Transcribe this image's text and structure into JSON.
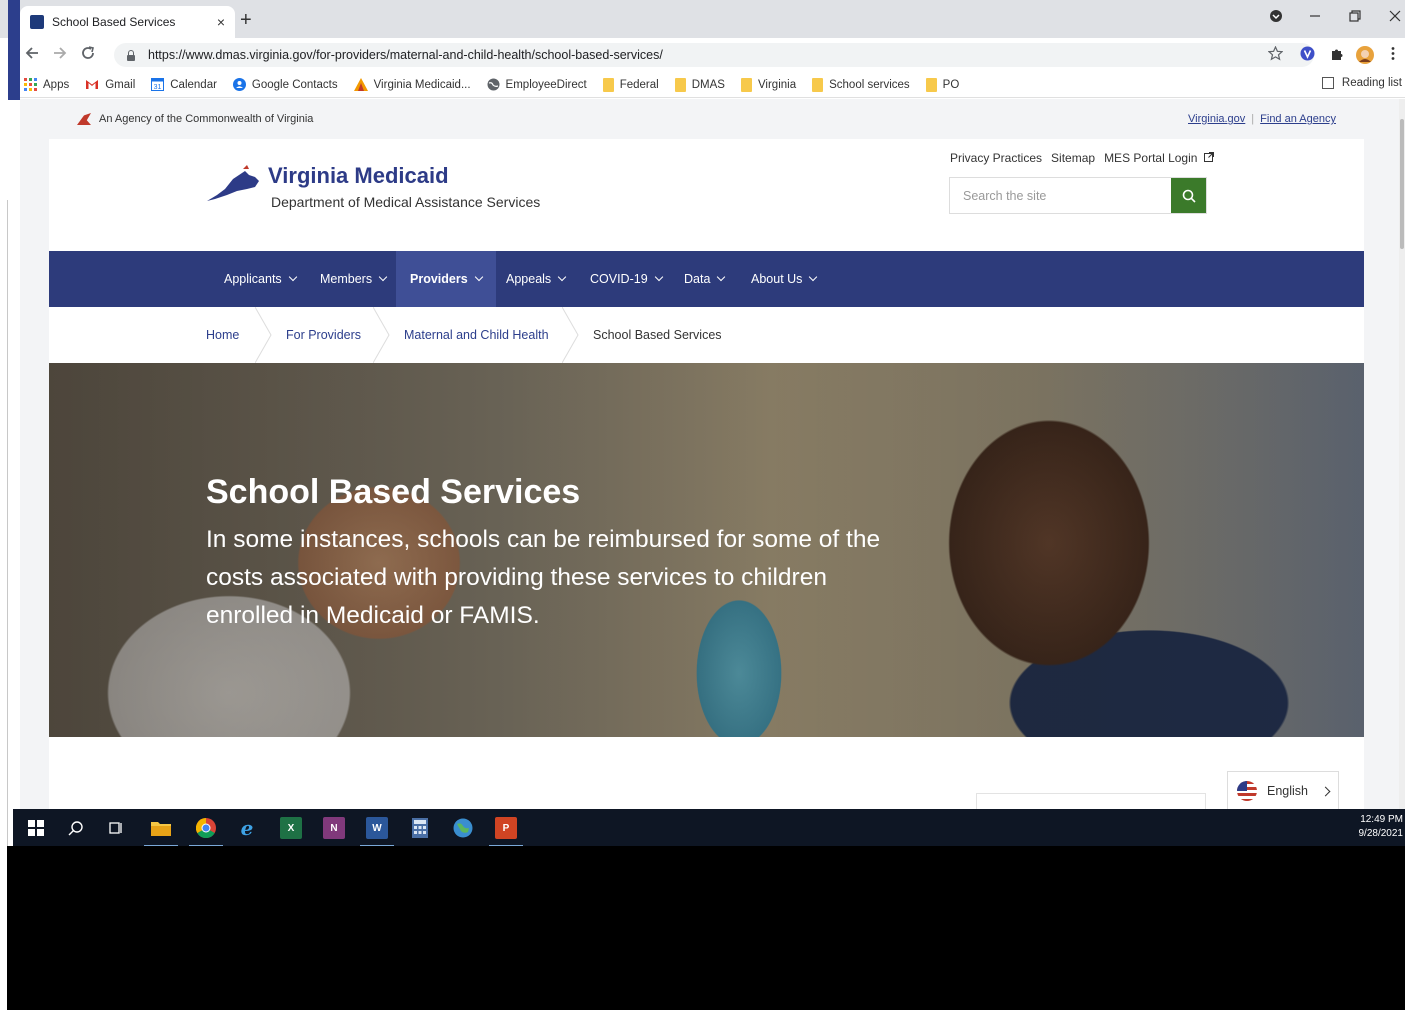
{
  "browser": {
    "tab_title": "School Based Services",
    "tab_close": "×",
    "new_tab": "+",
    "url": "https://www.dmas.virginia.gov/for-providers/maternal-and-child-health/school-based-services/",
    "bookmarks": [
      {
        "label": "Apps",
        "icon": "apps-grid-icon",
        "color": "#e44c41"
      },
      {
        "label": "Gmail",
        "icon": "gmail-icon",
        "color": "#d93025"
      },
      {
        "label": "Calendar",
        "icon": "calendar-icon",
        "color": "#1a73e8"
      },
      {
        "label": "Google Contacts",
        "icon": "contacts-icon",
        "color": "#1a73e8"
      },
      {
        "label": "Virginia Medicaid...",
        "icon": "medicaid-icon",
        "color": "#f29900"
      },
      {
        "label": "EmployeeDirect",
        "icon": "globe-icon",
        "color": "#5f6368"
      },
      {
        "label": "Federal",
        "icon": "folder-icon",
        "color": "#f7c94b"
      },
      {
        "label": "DMAS",
        "icon": "folder-icon",
        "color": "#f7c94b"
      },
      {
        "label": "Virginia",
        "icon": "folder-icon",
        "color": "#f7c94b"
      },
      {
        "label": "School services",
        "icon": "folder-icon",
        "color": "#f7c94b"
      },
      {
        "label": "PO",
        "icon": "folder-icon",
        "color": "#f7c94b"
      }
    ],
    "reading_list": "Reading list"
  },
  "site": {
    "agency_text": "An Agency of the Commonwealth of Virginia",
    "top_links": [
      "Virginia.gov",
      "Find an Agency"
    ],
    "logo_title": "Virginia Medicaid",
    "logo_subtitle": "Department of Medical Assistance Services",
    "util_links": [
      "Privacy Practices",
      "Sitemap",
      "MES Portal Login"
    ],
    "search_placeholder": "Search the site",
    "nav": [
      "Applicants",
      "Members",
      "Providers",
      "Appeals",
      "COVID-19",
      "Data",
      "About Us"
    ],
    "nav_active": "Providers",
    "breadcrumbs": [
      "Home",
      "For Providers",
      "Maternal and Child Health",
      "School Based Services"
    ],
    "hero_title": "School Based Services",
    "hero_text": "In some instances, schools can be reimbursed for some of the costs associated with providing these services to children enrolled in Medicaid or FAMIS.",
    "language": "English",
    "brand_color": "#2d3b7b",
    "search_button_color": "#3b7a2a"
  },
  "taskbar": {
    "apps": [
      "windows-start-icon",
      "search-icon",
      "task-view-icon",
      "file-explorer-icon",
      "chrome-icon",
      "internet-explorer-icon",
      "excel-icon",
      "onenote-icon",
      "word-icon",
      "calculator-icon",
      "globe-icon",
      "powerpoint-icon"
    ],
    "time": "12:49 PM",
    "date": "9/28/2021"
  }
}
